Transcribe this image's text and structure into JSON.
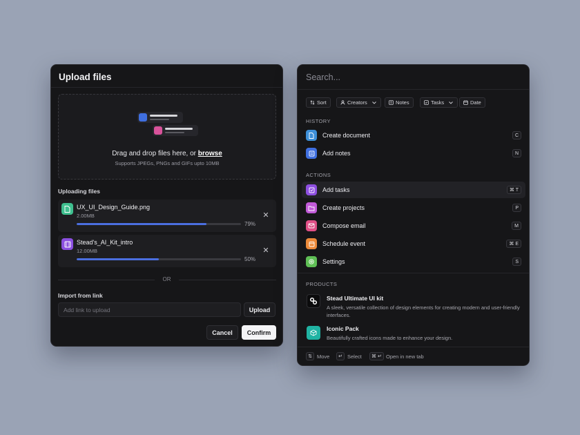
{
  "upload": {
    "title": "Upload files",
    "dropzone": {
      "text": "Drag and drop files here, or ",
      "browse": "browse",
      "supports": "Supports JPEGs, PNGs and GIFs upto 10MB"
    },
    "uploading_label": "Uploading files",
    "files": [
      {
        "name": "UX_UI_Design_Guide.png",
        "size": "2.00MB",
        "percent": "79%",
        "progress": 0.79,
        "icon": "document-icon",
        "color": "#3fbf8f"
      },
      {
        "name": "Stead's_AI_Kit_intro",
        "size": "12.00MB",
        "percent": "50%",
        "progress": 0.5,
        "icon": "film-icon",
        "color": "#8b4fe0"
      }
    ],
    "or_text": "OR",
    "import_label": "Import from link",
    "link_placeholder": "Add link to upload",
    "upload_button": "Upload",
    "cancel_button": "Cancel",
    "confirm_button": "Confirm"
  },
  "palette": {
    "search_placeholder": "Search...",
    "filters": [
      "Sort",
      "Creators",
      "Notes",
      "Tasks",
      "Date"
    ],
    "history_label": "HISTORY",
    "history": [
      {
        "label": "Create document",
        "key": "C",
        "icon": "document-icon",
        "color": "#3d8fd8"
      },
      {
        "label": "Add notes",
        "key": "N",
        "icon": "notes-icon",
        "color": "#3f6fe0"
      }
    ],
    "actions_label": "ACTIONS",
    "actions": [
      {
        "label": "Add tasks",
        "key": "⌘ T",
        "icon": "checkbox-icon",
        "color": "#8e4fe0"
      },
      {
        "label": "Create projects",
        "key": "P",
        "icon": "folder-icon",
        "color": "#c15ad8"
      },
      {
        "label": "Compose email",
        "key": "M",
        "icon": "mail-icon",
        "color": "#e04f86"
      },
      {
        "label": "Schedule event",
        "key": "⌘ E",
        "icon": "calendar-icon",
        "color": "#ec8a3a"
      },
      {
        "label": "Settings",
        "key": "S",
        "icon": "gear-icon",
        "color": "#5fbf55"
      }
    ],
    "products_label": "PRODUCTS",
    "products": [
      {
        "title": "Stead Ultimate UI kit",
        "desc": "A sleek, versatile collection of design elements for creating modern and user-friendly interfaces.",
        "icon": "link-icon",
        "color": "#0b0b0c"
      },
      {
        "title": "Iconic Pack",
        "desc": "Beautifully crafted icons made to enhance your design.",
        "icon": "box-icon",
        "color": "#20b3a3"
      }
    ],
    "footer": {
      "move": "Move",
      "select": "Select",
      "open_new_tab": "Open in new tab"
    }
  }
}
